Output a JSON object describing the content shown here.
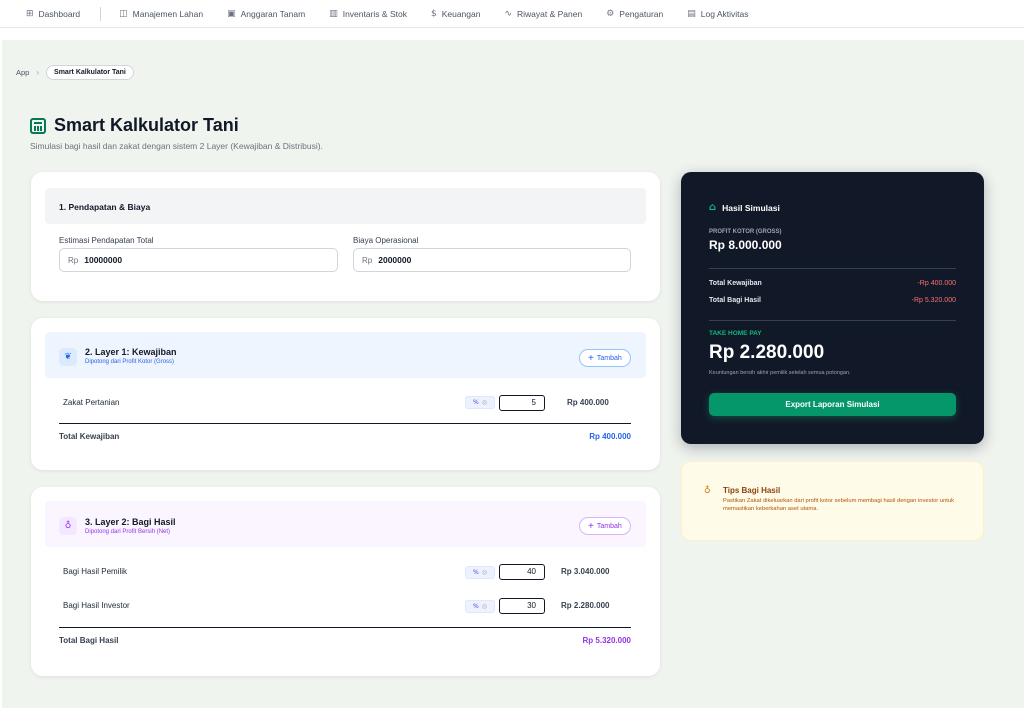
{
  "nav": {
    "items": [
      {
        "icon": "dashboard-icon",
        "glyph": "⊞",
        "label": "Dashboard"
      },
      {
        "icon": "map-icon",
        "glyph": "◫",
        "label": "Manajemen Lahan"
      },
      {
        "icon": "calendar-icon",
        "glyph": "▣",
        "label": "Anggaran Tanam"
      },
      {
        "icon": "warehouse-icon",
        "glyph": "▥",
        "label": "Inventaris & Stok"
      },
      {
        "icon": "dollar-icon",
        "glyph": "$",
        "label": "Keuangan"
      },
      {
        "icon": "activity-icon",
        "glyph": "∿",
        "label": "Riwayat & Panen"
      },
      {
        "icon": "settings-icon",
        "glyph": "⚙",
        "label": "Pengaturan"
      },
      {
        "icon": "log-icon",
        "glyph": "▤",
        "label": "Log Aktivitas"
      }
    ]
  },
  "breadcrumb": {
    "root": "App",
    "current": "Smart Kalkulator Tani"
  },
  "page": {
    "title": "Smart Kalkulator Tani",
    "subtitle": "Simulasi bagi hasil dan zakat dengan sistem 2 Layer (Kewajiban & Distribusi)."
  },
  "income": {
    "title": "1. Pendapatan & Biaya",
    "revenue_label": "Estimasi Pendapatan Total",
    "revenue_prefix": "Rp",
    "revenue_value": "10000000",
    "cost_label": "Biaya Operasional",
    "cost_prefix": "Rp",
    "cost_value": "2000000"
  },
  "layer1": {
    "title": "2. Layer 1: Kewajiban",
    "subtitle": "Dipotong dari Profit Kotor (Gross)",
    "add_label": "Tambah",
    "rows": [
      {
        "label": "Zakat Pertanian",
        "pct": "%",
        "value": "5",
        "amount": "Rp 400.000"
      }
    ],
    "total_label": "Total Kewajiban",
    "total_value": "Rp 400.000"
  },
  "layer2": {
    "title": "3. Layer 2: Bagi Hasil",
    "subtitle": "Dipotong dari Profit Bersih (Net)",
    "add_label": "Tambah",
    "rows": [
      {
        "label": "Bagi Hasil Pemilik",
        "pct": "%",
        "value": "40",
        "amount": "Rp 3.040.000"
      },
      {
        "label": "Bagi Hasil Investor",
        "pct": "%",
        "value": "30",
        "amount": "Rp 2.280.000"
      }
    ],
    "total_label": "Total Bagi Hasil",
    "total_value": "Rp 5.320.000"
  },
  "result": {
    "title": "Hasil Simulasi",
    "gross_label": "PROFIT KOTOR (GROSS)",
    "gross_value": "Rp 8.000.000",
    "obligation_label": "Total Kewajiban",
    "obligation_value": "-Rp 400.000",
    "share_label": "Total Bagi Hasil",
    "share_value": "-Rp 5.320.000",
    "thp_label": "TAKE HOME PAY",
    "thp_value": "Rp 2.280.000",
    "thp_note": "Keuntungan bersih akhir pemilik setelah semua potongan.",
    "export_label": "Export Laporan Simulasi"
  },
  "tips": {
    "title": "Tips Bagi Hasil",
    "text": "Pastikan Zakat dikeluarkan dari profit kotor sebelum membagi hasil dengan investor untuk memastikan keberkahan aset utama."
  },
  "colors": {
    "accent_green": "#059669",
    "layer1_color": "#2563eb",
    "layer2_color": "#9333ea",
    "negative": "#f87171",
    "dark_card": "#111827"
  }
}
